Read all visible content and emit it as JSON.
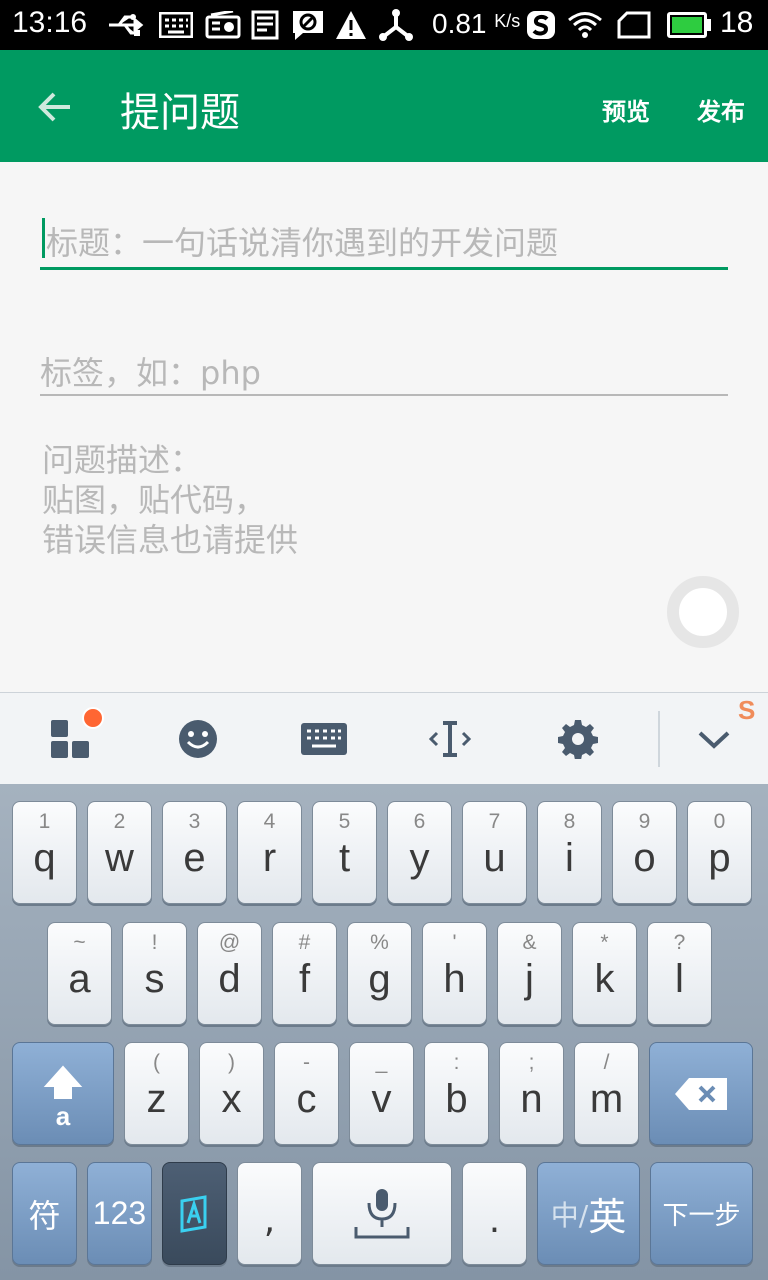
{
  "status_bar": {
    "time": "13:16",
    "net_speed": "0.81",
    "net_unit": "K/s",
    "battery_level": "18",
    "battery_color": "#2ecc40"
  },
  "app_bar": {
    "title": "提问题",
    "preview_label": "预览",
    "publish_label": "发布",
    "color": "#009a61"
  },
  "form": {
    "title_placeholder": "标题：一句话说清你遇到的开发问题",
    "tags_placeholder": "标签，如：php",
    "description_placeholder": "问题描述：\n贴图，贴代码，\n错误信息也请提供"
  },
  "keyboard": {
    "row1": [
      {
        "hint": "1",
        "letter": "q"
      },
      {
        "hint": "2",
        "letter": "w"
      },
      {
        "hint": "3",
        "letter": "e"
      },
      {
        "hint": "4",
        "letter": "r"
      },
      {
        "hint": "5",
        "letter": "t"
      },
      {
        "hint": "6",
        "letter": "y"
      },
      {
        "hint": "7",
        "letter": "u"
      },
      {
        "hint": "8",
        "letter": "i"
      },
      {
        "hint": "9",
        "letter": "o"
      },
      {
        "hint": "0",
        "letter": "p"
      }
    ],
    "row2": [
      {
        "hint": "~",
        "letter": "a"
      },
      {
        "hint": "!",
        "letter": "s"
      },
      {
        "hint": "@",
        "letter": "d"
      },
      {
        "hint": "#",
        "letter": "f"
      },
      {
        "hint": "%",
        "letter": "g"
      },
      {
        "hint": "'",
        "letter": "h"
      },
      {
        "hint": "&",
        "letter": "j"
      },
      {
        "hint": "*",
        "letter": "k"
      },
      {
        "hint": "?",
        "letter": "l"
      }
    ],
    "row3": [
      {
        "hint": "(",
        "letter": "z"
      },
      {
        "hint": ")",
        "letter": "x"
      },
      {
        "hint": "-",
        "letter": "c"
      },
      {
        "hint": "_",
        "letter": "v"
      },
      {
        "hint": ":",
        "letter": "b"
      },
      {
        "hint": ";",
        "letter": "n"
      },
      {
        "hint": "/",
        "letter": "m"
      }
    ],
    "shift_letter": "a",
    "symbols_label": "符",
    "numbers_label": "123",
    "comma_label": ",",
    "period_label": ".",
    "lang_zh": "中/",
    "lang_en": "英",
    "next_label": "下一步"
  }
}
